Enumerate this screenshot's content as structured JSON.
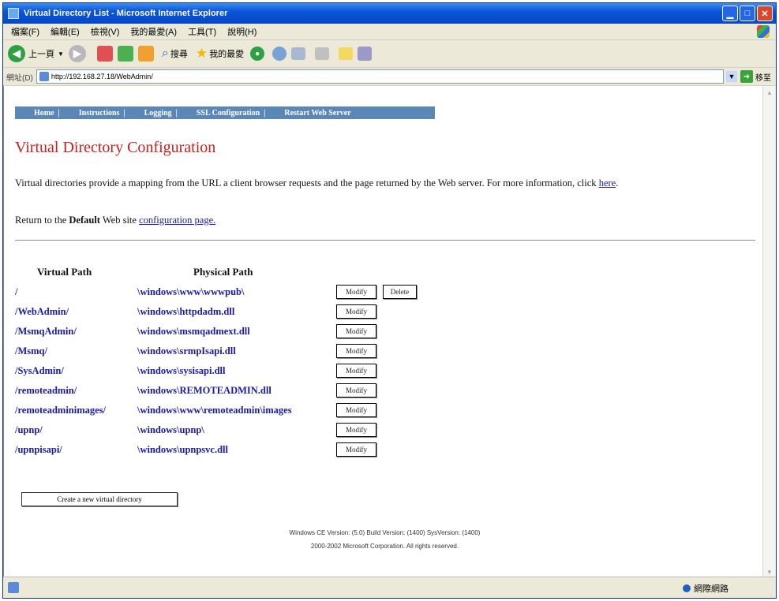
{
  "window": {
    "title": "Virtual Directory List - Microsoft Internet Explorer"
  },
  "menu": [
    "檔案(F)",
    "編輯(E)",
    "檢視(V)",
    "我的最愛(A)",
    "工具(T)",
    "說明(H)"
  ],
  "toolbar": {
    "back_label": "上一頁",
    "search_label": "搜尋",
    "favorites_label": "我的最愛"
  },
  "address": {
    "label": "網址(D)",
    "url": "http://192.168.27.18/WebAdmin/",
    "go_label": "移至"
  },
  "nav": [
    "Home",
    "Instructions",
    "Logging",
    "SSL Configuration",
    "Restart Web Server"
  ],
  "page": {
    "title": "Virtual Directory Configuration",
    "intro": "Virtual directories provide a mapping from the URL a client browser requests and the page returned by the Web server. For more information, click",
    "intro_link": "here",
    "return_pre": "Return to the",
    "return_bold": "Default",
    "return_mid": "Web site",
    "return_link": "configuration page."
  },
  "table": {
    "headers": [
      "Virtual Path",
      "Physical Path"
    ],
    "rows": [
      {
        "virtual": "/",
        "physical": "\\windows\\www\\wwwpub\\",
        "actions": [
          "Modify",
          "Delete"
        ]
      },
      {
        "virtual": "/WebAdmin/",
        "physical": "\\windows\\httpdadm.dll",
        "actions": [
          "Modify"
        ]
      },
      {
        "virtual": "/MsmqAdmin/",
        "physical": "\\windows\\msmqadmext.dll",
        "actions": [
          "Modify"
        ]
      },
      {
        "virtual": "/Msmq/",
        "physical": "\\windows\\srmpIsapi.dll",
        "actions": [
          "Modify"
        ]
      },
      {
        "virtual": "/SysAdmin/",
        "physical": "\\windows\\sysisapi.dll",
        "actions": [
          "Modify"
        ]
      },
      {
        "virtual": "/remoteadmin/",
        "physical": "\\windows\\REMOTEADMIN.dll",
        "actions": [
          "Modify"
        ]
      },
      {
        "virtual": "/remoteadminimages/",
        "physical": "\\windows\\www\\remoteadmin\\images",
        "actions": [
          "Modify"
        ]
      },
      {
        "virtual": "/upnp/",
        "physical": "\\windows\\upnp\\",
        "actions": [
          "Modify"
        ]
      },
      {
        "virtual": "/upnpisapi/",
        "physical": "\\windows\\upnpsvc.dll",
        "actions": [
          "Modify"
        ]
      }
    ]
  },
  "create_button": "Create a new virtual directory",
  "footer": {
    "line1": "Windows CE Version: (5.0) Build Version: (1400) SysVersion: (1400)",
    "line2": "2000-2002 Microsoft Corporation. All rights reserved."
  },
  "status": {
    "zone": "網際網路"
  },
  "colors": {
    "title_red": "#cc1f1f",
    "link_blue": "#1a1aa8",
    "nav_blue": "#5b87b8",
    "xp_titlebar": "#0a55d8"
  }
}
